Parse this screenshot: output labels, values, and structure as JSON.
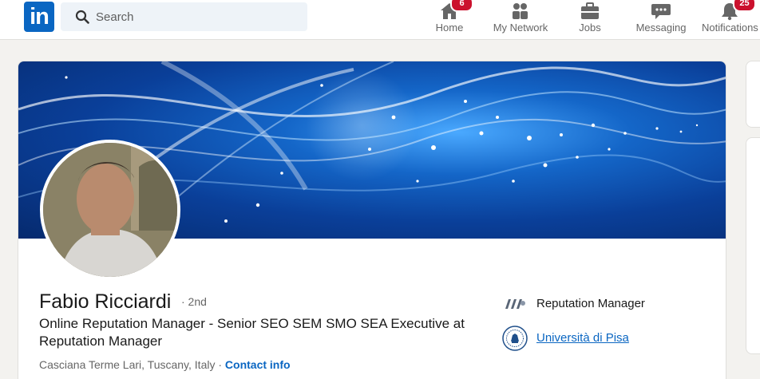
{
  "brand": {
    "logo_text": "in",
    "accent": "#0a66c2"
  },
  "search": {
    "placeholder": "Search",
    "value": ""
  },
  "nav": {
    "items": [
      {
        "label": "Home",
        "icon": "home-icon",
        "badge": "6"
      },
      {
        "label": "My Network",
        "icon": "my-network-icon"
      },
      {
        "label": "Jobs",
        "icon": "briefcase-icon"
      },
      {
        "label": "Messaging",
        "icon": "messaging-icon"
      },
      {
        "label": "Notifications",
        "icon": "bell-icon",
        "badge": "25"
      }
    ],
    "badge_color": "#cb112d"
  },
  "profile": {
    "name": "Fabio Ricciardi",
    "degree": "· 2nd",
    "headline": "Online Reputation Manager - Senior SEO SEM SMO SEA Executive at Reputation Manager",
    "location": "Casciana Terme Lari, Tuscany, Italy",
    "location_separator": " · ",
    "contact_label": "Contact info",
    "orgs": [
      {
        "label": "Reputation Manager",
        "icon": "company-logo-icon"
      },
      {
        "label": "Università di Pisa",
        "icon": "university-seal-icon"
      }
    ]
  }
}
